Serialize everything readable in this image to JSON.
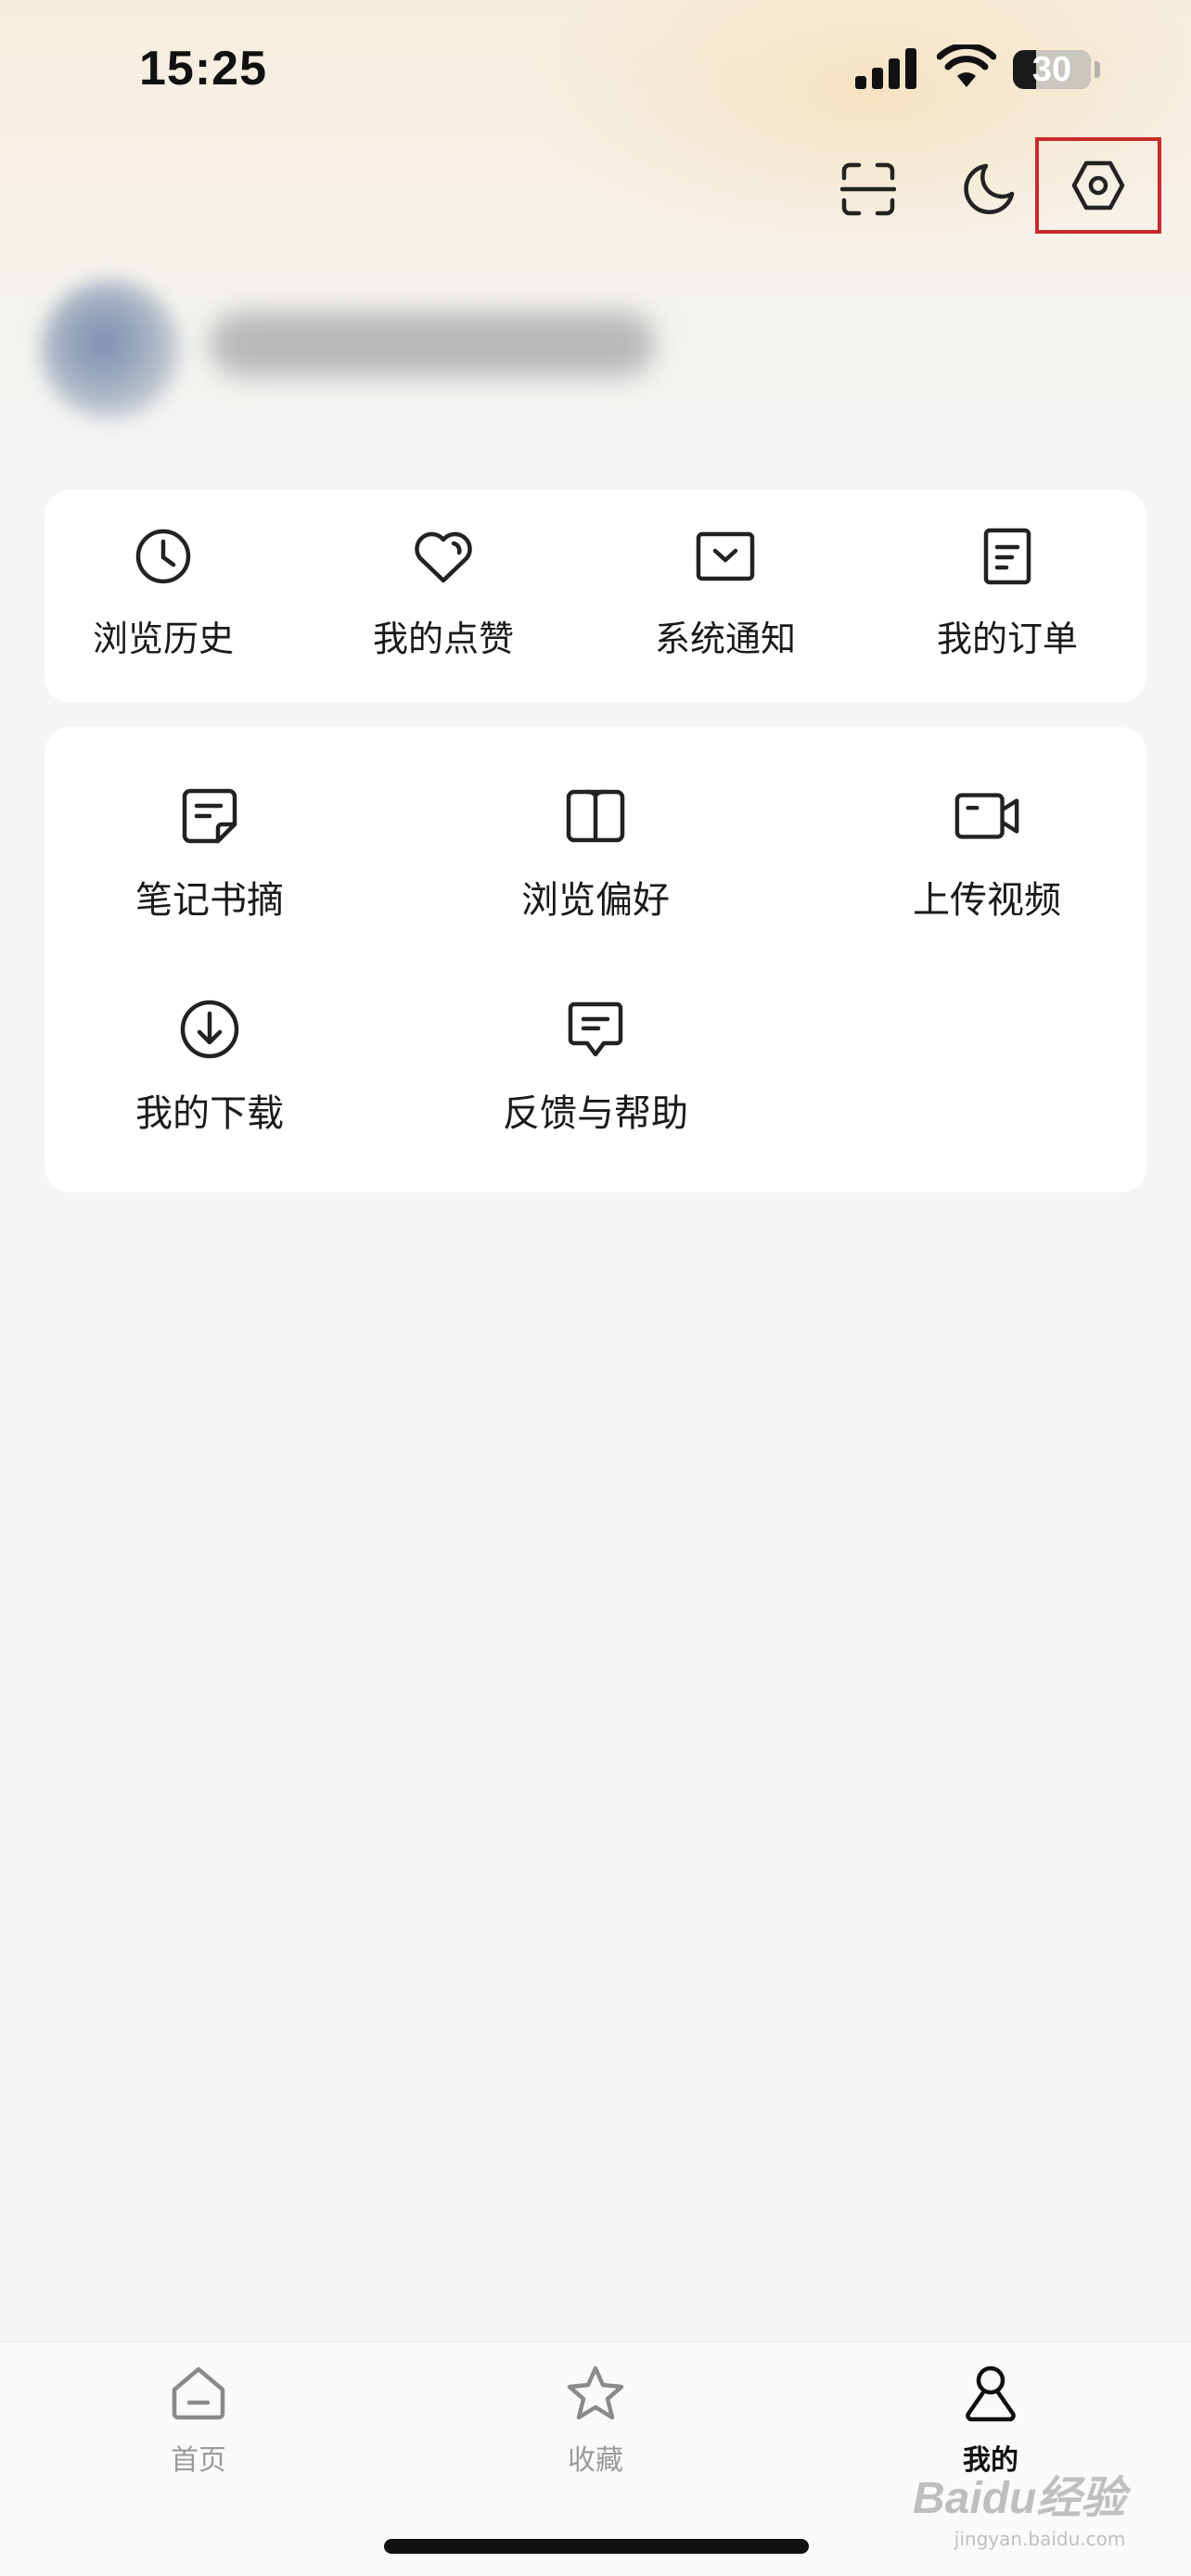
{
  "status_bar": {
    "time": "15:25",
    "battery_level": 30,
    "battery_text": "30"
  },
  "header": {
    "icons": [
      "scan-icon",
      "moon-icon",
      "settings-icon"
    ],
    "highlight_color": "#c82a2a"
  },
  "quick_actions": [
    {
      "label": "浏览历史",
      "icon": "clock-icon"
    },
    {
      "label": "我的点赞",
      "icon": "heart-icon"
    },
    {
      "label": "系统通知",
      "icon": "notification-icon"
    },
    {
      "label": "我的订单",
      "icon": "order-icon"
    }
  ],
  "tools": [
    {
      "label": "笔记书摘",
      "icon": "note-icon"
    },
    {
      "label": "浏览偏好",
      "icon": "book-icon"
    },
    {
      "label": "上传视频",
      "icon": "video-camera-icon"
    },
    {
      "label": "我的下载",
      "icon": "download-icon"
    },
    {
      "label": "反馈与帮助",
      "icon": "feedback-icon"
    }
  ],
  "tab_bar": {
    "tabs": [
      {
        "label": "首页",
        "icon": "home-icon",
        "active": false
      },
      {
        "label": "收藏",
        "icon": "star-icon",
        "active": false
      },
      {
        "label": "我的",
        "icon": "person-icon",
        "active": true
      }
    ]
  },
  "watermark": {
    "main": "Baidu经验",
    "sub": "jingyan.baidu.com"
  }
}
